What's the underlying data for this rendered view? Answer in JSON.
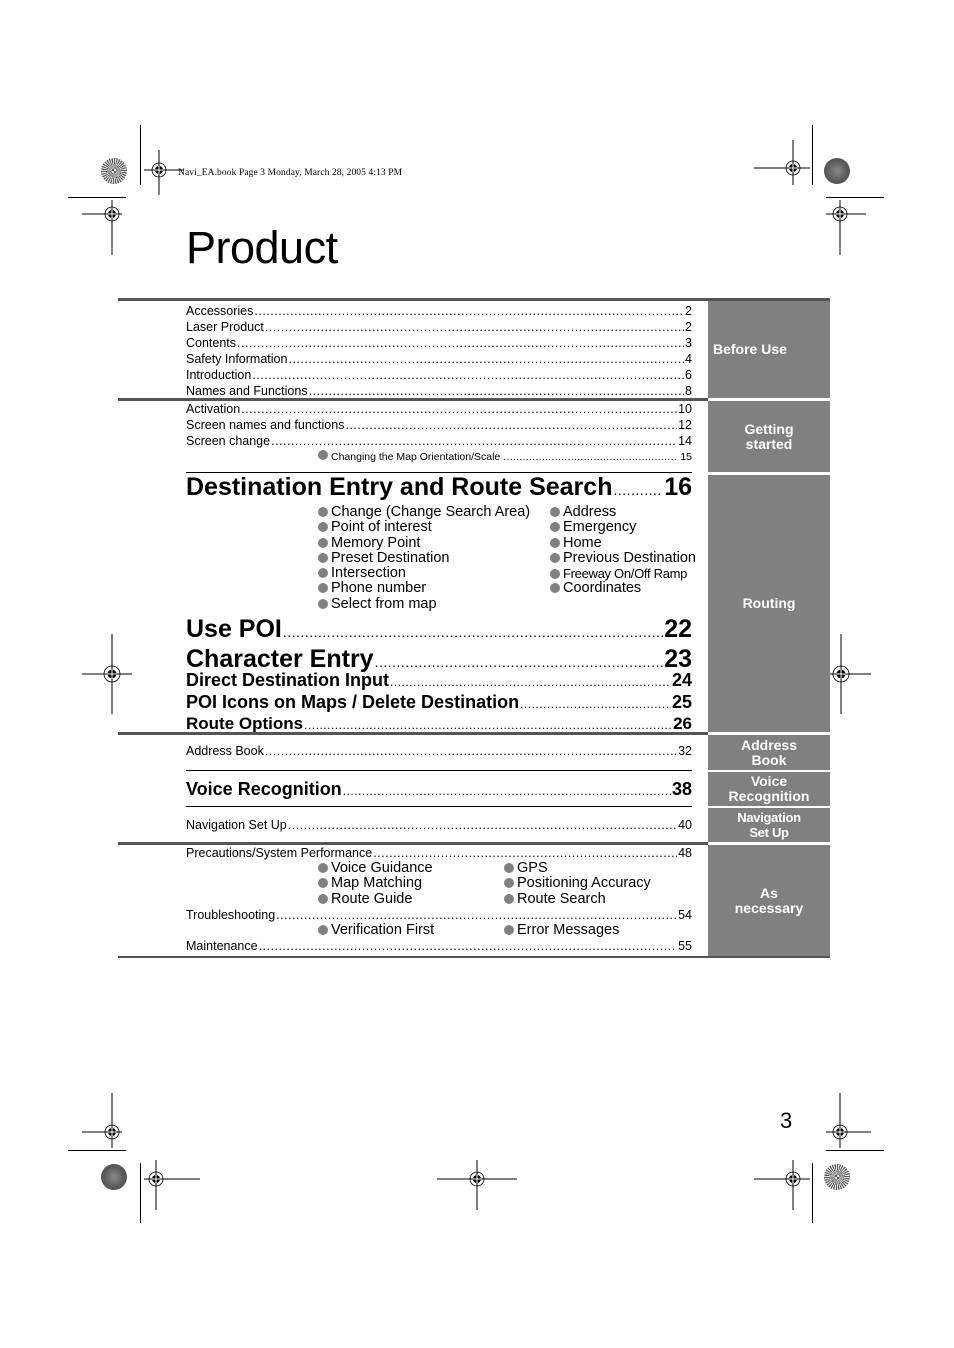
{
  "document": {
    "slug": "Navi_EA.book  Page 3  Monday, March 28, 2005  4:13 PM",
    "title": "Product",
    "page_number": "3",
    "colors": {
      "tab_gray": "#808080",
      "rule_gray": "#555555",
      "bullet_gray": "#808080"
    }
  },
  "toc": {
    "before_use": {
      "tab": "Before Use",
      "items": [
        {
          "label": "Accessories",
          "page": "2"
        },
        {
          "label": "Laser Product",
          "page": "2"
        },
        {
          "label": "Contents",
          "page": "3"
        },
        {
          "label": "Safety Information",
          "page": "4"
        },
        {
          "label": "Introduction",
          "page": "6"
        },
        {
          "label": "Names and Functions",
          "page": "8"
        }
      ]
    },
    "getting_started": {
      "tab": "Getting\nstarted",
      "items": [
        {
          "label": "Activation",
          "page": "10"
        },
        {
          "label": "Screen names and functions",
          "page": "12"
        },
        {
          "label": "Screen change",
          "page": "14"
        }
      ],
      "sub_note": {
        "label": "Changing the Map Orientation/Scale",
        "page": "15"
      }
    },
    "routing": {
      "tab": "Routing",
      "destination": {
        "label": "Destination Entry and Route Search",
        "page": "16"
      },
      "destination_bullets": [
        "Change (Change Search Area)",
        "Address",
        "Point of interest",
        "Emergency",
        "Memory Point",
        "Home",
        "Preset Destination",
        "Previous Destination",
        "Intersection",
        "Freeway On/Off Ramp",
        "Phone number",
        "Coordinates",
        "Select from map"
      ],
      "use_poi": {
        "label": "Use POI",
        "page": "22"
      },
      "character_entry": {
        "label": "Character Entry",
        "page": "23"
      },
      "direct_destination": {
        "label": "Direct Destination Input",
        "page": "24"
      },
      "poi_icons": {
        "label": "POI Icons on Maps / Delete Destination",
        "page": "25"
      },
      "route_options": {
        "label": "Route Options",
        "page": "26"
      }
    },
    "address_book": {
      "tab": "Address\nBook",
      "item": {
        "label": "Address Book",
        "page": "32"
      }
    },
    "voice_recognition": {
      "tab": "Voice\nRecognition",
      "item": {
        "label": "Voice Recognition",
        "page": "38"
      }
    },
    "navigation_setup": {
      "tab": "Navigation\nSet Up",
      "item": {
        "label": "Navigation Set Up",
        "page": "40"
      }
    },
    "as_necessary": {
      "tab": "As\nnecessary",
      "precautions": {
        "label": "Precautions/System Performance",
        "page": "48"
      },
      "precautions_bullets": [
        "Voice Guidance",
        "GPS",
        "Map Matching",
        "Positioning Accuracy",
        "Route Guide",
        "Route Search"
      ],
      "troubleshooting": {
        "label": "Troubleshooting",
        "page": "54"
      },
      "troubleshooting_bullets": [
        "Verification First",
        "Error Messages"
      ],
      "maintenance": {
        "label": "Maintenance",
        "page": "55"
      }
    }
  }
}
